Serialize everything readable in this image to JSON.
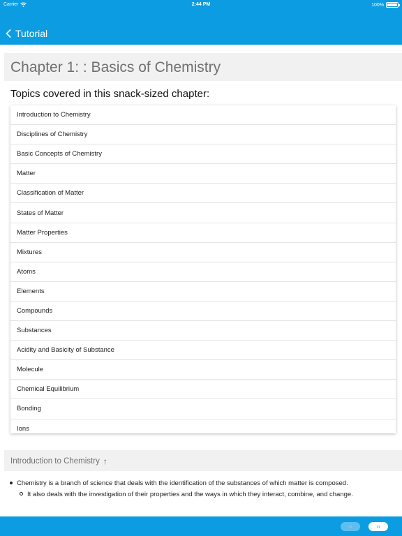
{
  "status_bar": {
    "carrier": "Carrier",
    "time": "2:44 PM",
    "battery": "100%",
    "battery_level": 1.0
  },
  "nav": {
    "back_label": "Tutorial"
  },
  "chapter": {
    "title": "Chapter 1: : Basics of Chemistry",
    "subtitle": "Topics covered in this snack-sized chapter:",
    "topics": [
      "Introduction to Chemistry",
      "Disciplines of Chemistry",
      "Basic Concepts of Chemistry",
      "Matter",
      "Classification of Matter",
      "States of Matter",
      "Matter Properties",
      "Mixtures",
      "Atoms",
      "Elements",
      "Compounds",
      "Substances",
      "Acidity and Basicity of Substance",
      "Molecule",
      "Chemical Equilibrium",
      "Bonding",
      "Ions"
    ]
  },
  "section": {
    "title": "Introduction to Chemistry",
    "up_icon": "↑",
    "bullet_1": "Chemistry is a branch of science that deals with the identification of the substances of which matter is composed.",
    "bullet_2": "It also deals with the investigation of their properties and the ways in which they interact, combine, and change."
  },
  "pager": {
    "prev_label": "‹‹",
    "next_label": "››"
  },
  "colors": {
    "brand": "#0c9ce2",
    "band": "#f1f1f1"
  }
}
